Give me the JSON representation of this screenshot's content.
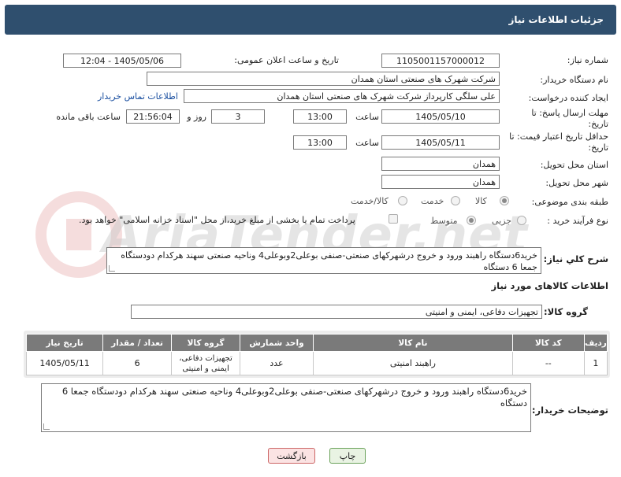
{
  "header": {
    "title": "جزئیات اطلاعات نیاز"
  },
  "labels": {
    "need_number": "شماره نیاز:",
    "announce_datetime": "تاریخ و ساعت اعلان عمومی:",
    "buyer_org": "نام دستگاه خریدار:",
    "requester": "ایجاد کننده درخواست:",
    "reply_deadline": "مهلت ارسال پاسخ: تا تاریخ:",
    "price_validity": "حداقل تاریخ اعتبار قیمت: تا تاریخ:",
    "time": "ساعت",
    "day_and": "روز و",
    "remaining": "ساعت باقی مانده",
    "province": "استان محل تحویل:",
    "city": "شهر محل تحویل:",
    "category": "طبقه بندی موضوعی:",
    "purchase_type": "نوع فرآیند خرید :",
    "description": "شرح کلي نياز:",
    "goods_info": "اطلاعات کالاهای مورد نیاز",
    "goods_group": "گروه کالا:",
    "buyer_notes": "توضیحات خریدار:"
  },
  "fields": {
    "need_number": "1105001157000012",
    "announce_datetime": "1405/05/06 - 12:04",
    "buyer_org": "شرکت شهرک های صنعتی استان همدان",
    "requester": "علی سلگی کارپرداز شرکت شهرک های صنعتی استان همدان",
    "buyer_contact_link": "اطلاعات تماس خریدار",
    "reply_date": "1405/05/10",
    "reply_time": "13:00",
    "reply_days": "3",
    "reply_remaining": "21:56:04",
    "validity_date": "1405/05/11",
    "validity_time": "13:00",
    "province": "همدان",
    "city": "همدان",
    "goods_group": "تجهیزات دفاعی، ایمنی و امنیتی"
  },
  "category_options": {
    "goods": "کالا",
    "service": "خدمت",
    "goods_service": "کالا/خدمت"
  },
  "purchase_options": {
    "partial": "جزیی",
    "medium": "متوسط",
    "payment_note": "پرداخت تمام یا بخشی از مبلغ خرید،از محل \"اسناد خزانه اسلامی\" خواهد بود."
  },
  "description_text": "خرید6دستگاه راهبند ورود و خروج درشهرکهای صنعتی-صنفی بوعلی2وبوعلی4 وناحیه صنعتی سهند هرکدام دودستگاه جمعا 6 دستگاه",
  "buyer_notes_text": "خرید6دستگاه راهبند ورود و خروج درشهرکهای صنعتی-صنفی بوعلی2وبوعلی4 وناحیه صنعتی سهند هرکدام دودستگاه جمعا 6 دستگاه",
  "table": {
    "headers": [
      "ردیف",
      "کد کالا",
      "نام کالا",
      "واحد شمارش",
      "گروه کالا",
      "تعداد / مقدار",
      "تاریخ نیاز"
    ],
    "rows": [
      [
        "1",
        "--",
        "راهبند امنیتی",
        "عدد",
        "تجهیزات دفاعی، ایمنی و امنیتی",
        "6",
        "1405/05/11"
      ]
    ]
  },
  "buttons": {
    "print": "چاپ",
    "back": "بازگشت"
  },
  "watermark": "AriaTender.net",
  "colors": {
    "header": "#2f4f6e",
    "table_header": "#7a7a7a",
    "link": "#1a4fa0"
  }
}
